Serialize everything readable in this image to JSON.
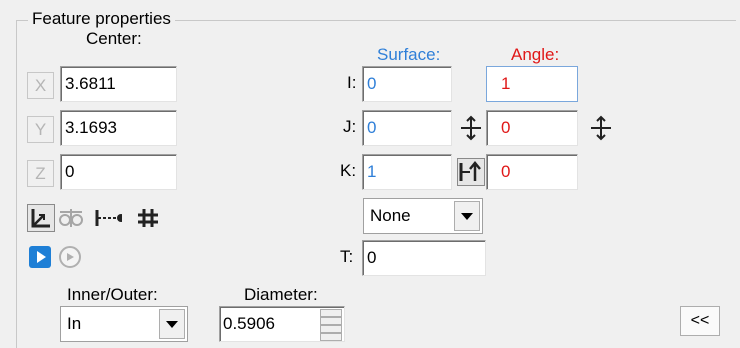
{
  "panel": {
    "title": "Feature properties",
    "collapse_label": "<<"
  },
  "center": {
    "label": "Center:",
    "x_axis": "X",
    "y_axis": "Y",
    "z_axis": "Z",
    "x_value": "3.6811",
    "y_value": "3.1693",
    "z_value": "0"
  },
  "vector": {
    "surface_label": "Surface:",
    "angle_label": "Angle:",
    "i_label": "I:",
    "j_label": "J:",
    "k_label": "K:",
    "t_label": "T:",
    "surface_i": "0",
    "surface_j": "0",
    "surface_k": "1",
    "angle_i": "1",
    "angle_j": "0",
    "angle_k": "0",
    "t_value": "0",
    "none_option": "None"
  },
  "inner_outer": {
    "label": "Inner/Outer:",
    "value": "In"
  },
  "diameter": {
    "label": "Diameter:",
    "value": "0.5906"
  },
  "colors": {
    "surface": "#2f7fd8",
    "angle": "#e01818"
  },
  "icons": [
    "axis-icon",
    "measure-icon",
    "point-line-icon",
    "grid-icon",
    "play-icon",
    "replay-icon",
    "flip-icon",
    "normal-icon"
  ]
}
